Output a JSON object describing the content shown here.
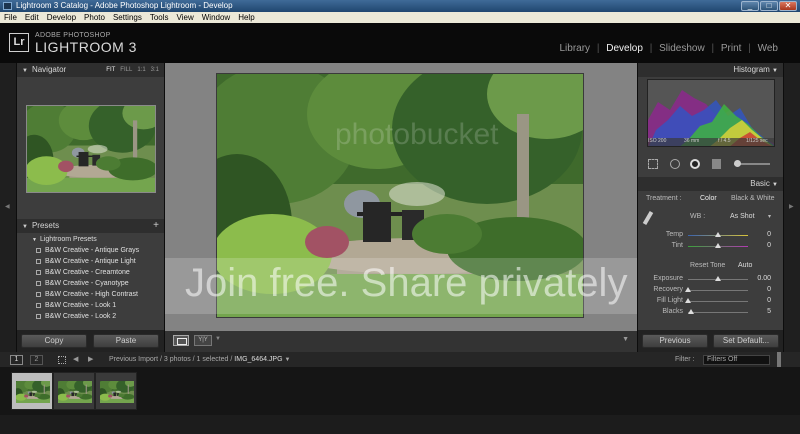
{
  "window": {
    "title": "Lightroom 3 Catalog - Adobe Photoshop Lightroom - Develop",
    "min": "_",
    "max": "□",
    "close": "✕"
  },
  "menu": [
    "File",
    "Edit",
    "Develop",
    "Photo",
    "Settings",
    "Tools",
    "View",
    "Window",
    "Help"
  ],
  "identity": {
    "logo": "Lr",
    "vendor": "ADOBE PHOTOSHOP",
    "product": "LIGHTROOM 3"
  },
  "modules": {
    "library": "Library",
    "develop": "Develop",
    "slideshow": "Slideshow",
    "print": "Print",
    "web": "Web",
    "separator": "|",
    "active": "Develop"
  },
  "navigator": {
    "title": "Navigator",
    "zoom": [
      "FIT",
      "FILL",
      "1:1",
      "3:1"
    ]
  },
  "presets": {
    "title": "Presets",
    "add": "+",
    "group": "Lightroom Presets",
    "items": [
      "B&W Creative - Antique Grays",
      "B&W Creative - Antique Light",
      "B&W Creative - Creamtone",
      "B&W Creative - Cyanotype",
      "B&W Creative - High Contrast",
      "B&W Creative - Look 1",
      "B&W Creative - Look 2"
    ]
  },
  "left_buttons": {
    "copy": "Copy",
    "paste": "Paste"
  },
  "toolbar": {
    "before_after": "Y|Y",
    "menu_arrow": "▼"
  },
  "histogram": {
    "title": "Histogram",
    "iso": "ISO 200",
    "focal": "36 mm",
    "aperture": "f / 4.5",
    "shutter": "1/125 sec"
  },
  "basic": {
    "title": "Basic",
    "treatment_label": "Treatment :",
    "color": "Color",
    "bw": "Black & White",
    "wb_label": "WB :",
    "wb_value": "As Shot",
    "sliders": [
      {
        "label": "Temp",
        "value": "0",
        "pos": 0.5
      },
      {
        "label": "Tint",
        "value": "0",
        "pos": 0.5
      }
    ],
    "tone_label": "Reset Tone",
    "tone_auto": "Auto",
    "tone_sliders": [
      {
        "label": "Exposure",
        "value": "0.00",
        "pos": 0.5
      },
      {
        "label": "Recovery",
        "value": "0",
        "pos": 0.0
      },
      {
        "label": "Fill Light",
        "value": "0",
        "pos": 0.0
      },
      {
        "label": "Blacks",
        "value": "5",
        "pos": 0.05
      }
    ]
  },
  "right_buttons": {
    "previous": "Previous",
    "reset": "Set Default..."
  },
  "filmbar": {
    "page1": "1",
    "page2": "2",
    "source": "Previous Import / 3 photos / 1 selected / ",
    "filename": "IMG_6464.JPG",
    "filter_label": "Filter :",
    "filter_value": "Filters Off"
  },
  "watermark": {
    "brand": "photobucket",
    "slogan": "Join free. Share privately"
  }
}
